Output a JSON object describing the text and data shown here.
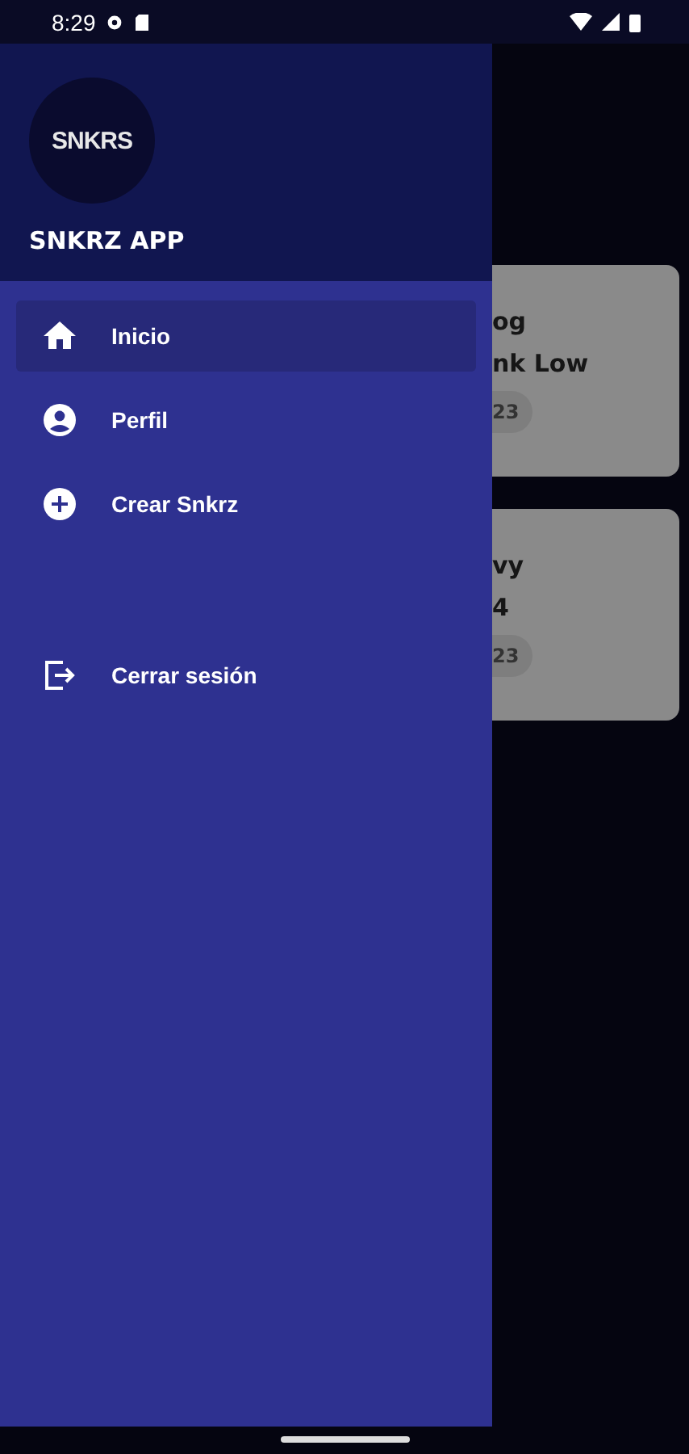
{
  "status_bar": {
    "time": "8:29"
  },
  "drawer": {
    "logo": "SNKRS",
    "title": "SNKRZ APP",
    "items": [
      {
        "kind": "home",
        "label": "Inicio",
        "selected": true
      },
      {
        "kind": "profile",
        "label": "Perfil",
        "selected": false
      },
      {
        "kind": "add",
        "label": "Crear Snkrz",
        "selected": false
      }
    ],
    "logout": {
      "kind": "logout",
      "label": "Cerrar sesión"
    }
  },
  "cards": [
    {
      "line_1": "og",
      "line_2": "nk Low",
      "chip": "23"
    },
    {
      "line_1": "vy",
      "line_2": "4",
      "chip": "23"
    }
  ]
}
